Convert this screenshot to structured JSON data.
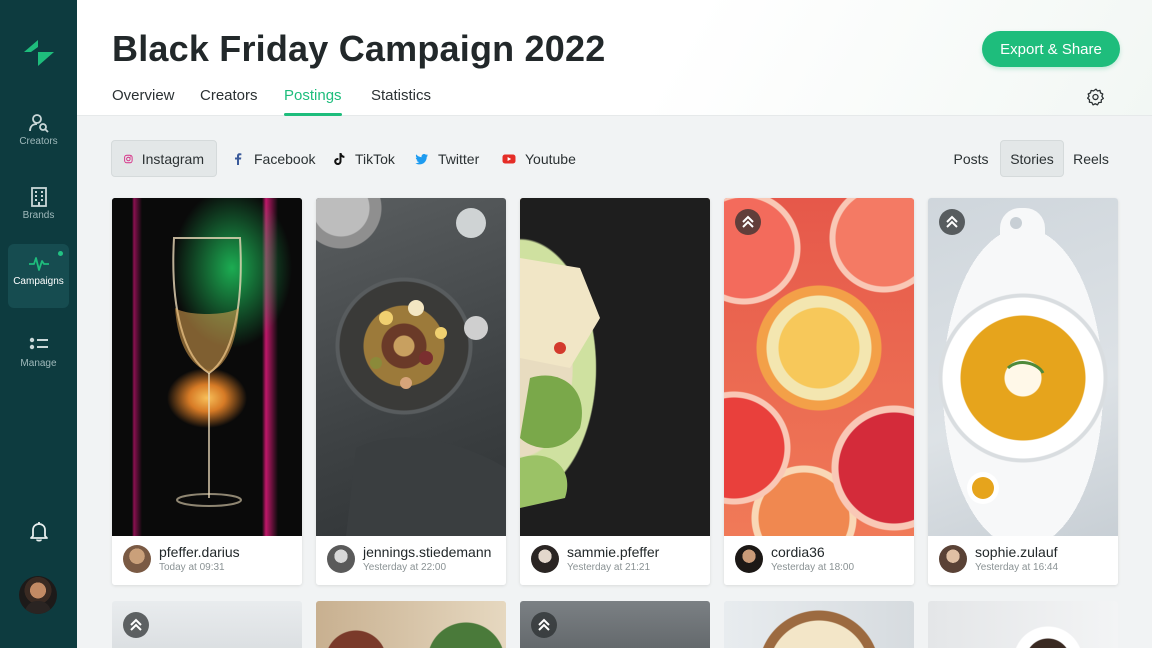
{
  "sidebar": {
    "items": [
      {
        "label": "Creators",
        "icon": "creators-icon"
      },
      {
        "label": "Brands",
        "icon": "building-icon"
      },
      {
        "label": "Campaigns",
        "icon": "pulse-icon"
      },
      {
        "label": "Manage",
        "icon": "list-icon"
      }
    ],
    "active_index": 2
  },
  "header": {
    "title": "Black Friday Campaign 2022",
    "export_label": "Export & Share",
    "tabs": [
      "Overview",
      "Creators",
      "Postings",
      "Statistics"
    ],
    "active_tab": "Postings"
  },
  "platforms": {
    "items": [
      "Instagram",
      "Facebook",
      "TikTok",
      "Twitter",
      "Youtube"
    ],
    "selected": "Instagram"
  },
  "content_types": {
    "items": [
      "Posts",
      "Stories",
      "Reels"
    ],
    "selected": "Stories"
  },
  "posts": [
    {
      "username": "pfeffer.darius",
      "time": "Today at 09:31"
    },
    {
      "username": "jennings.stiedemann",
      "time": "Yesterday at 22:00"
    },
    {
      "username": "sammie.pfeffer",
      "time": "Yesterday at 21:21"
    },
    {
      "username": "cordia36",
      "time": "Yesterday at 18:00"
    },
    {
      "username": "sophie.zulauf",
      "time": "Yesterday at 16:44"
    }
  ],
  "colors": {
    "accent": "#1ebd7c",
    "sidebar": "#0d3b3f",
    "sidebar_active": "#164c50"
  }
}
